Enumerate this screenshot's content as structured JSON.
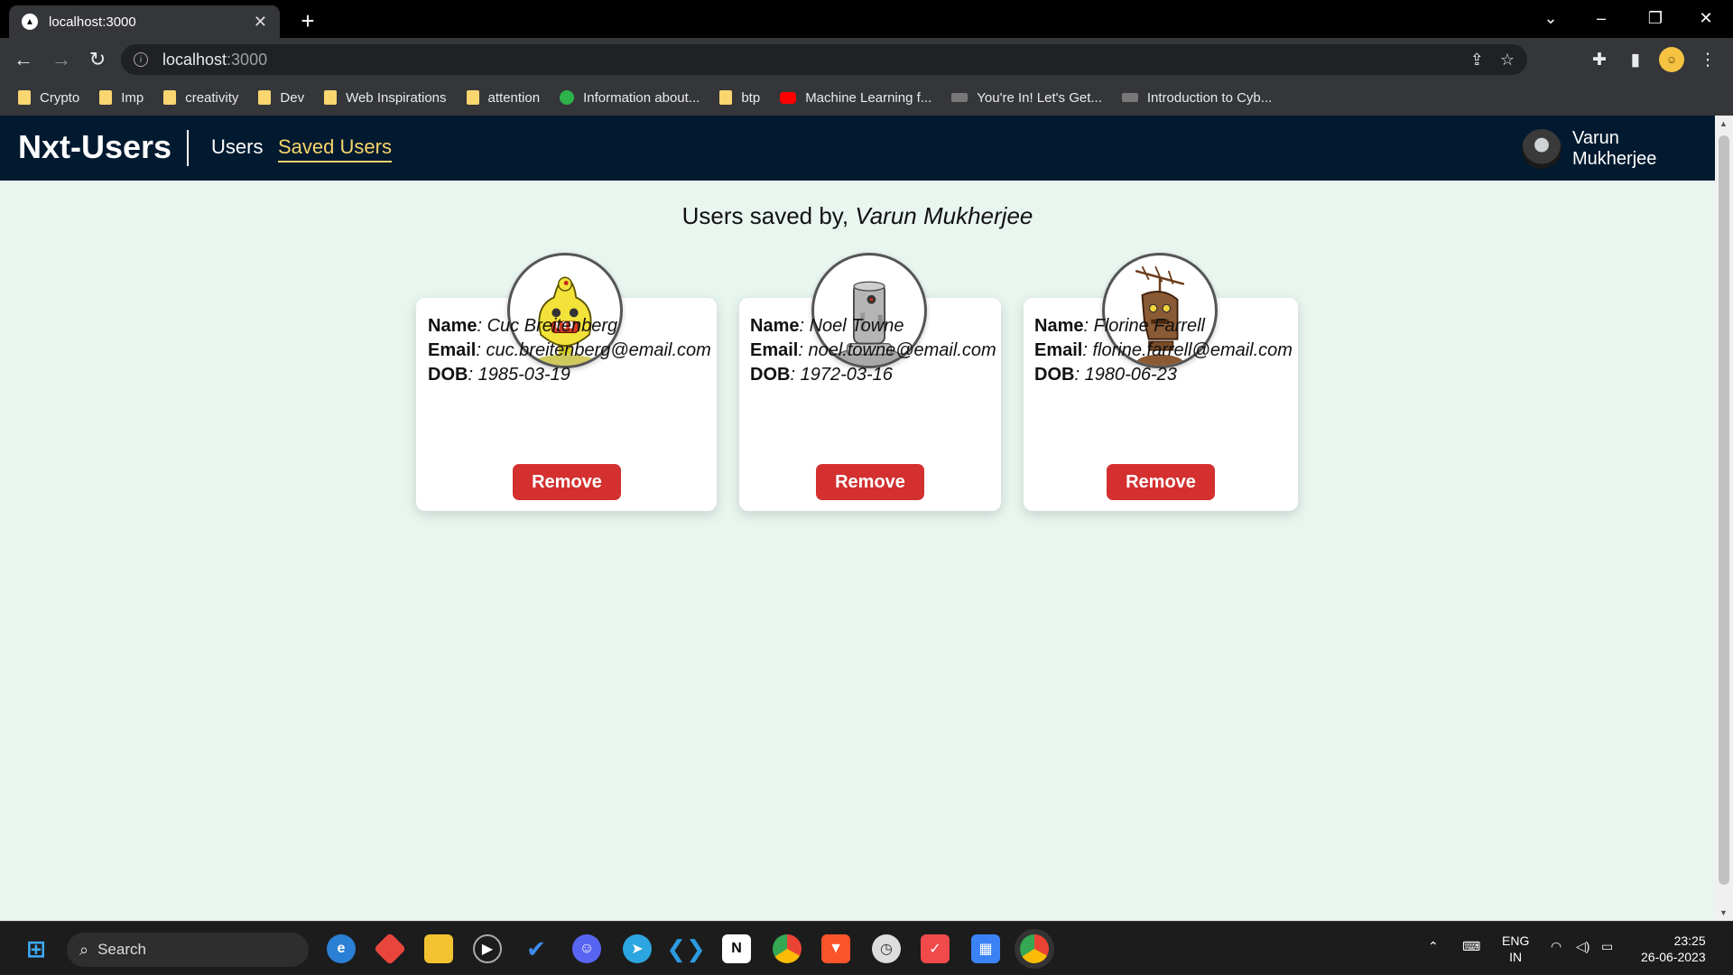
{
  "browser": {
    "tab_title": "localhost:3000",
    "tab_close": "✕",
    "new_tab": "+",
    "url_host": "localhost",
    "url_port": ":3000",
    "bookmarks": [
      {
        "label": "Crypto",
        "icon": "folder-icon"
      },
      {
        "label": "Imp",
        "icon": "folder-icon"
      },
      {
        "label": "creativity",
        "icon": "folder-icon"
      },
      {
        "label": "Dev",
        "icon": "folder-icon"
      },
      {
        "label": "Web Inspirations",
        "icon": "folder-icon"
      },
      {
        "label": "attention",
        "icon": "folder-icon"
      },
      {
        "label": "Information about...",
        "icon": "tv-icon"
      },
      {
        "label": "btp",
        "icon": "folder-icon"
      },
      {
        "label": "Machine Learning f...",
        "icon": "youtube-icon"
      },
      {
        "label": "You're In! Let's Get...",
        "icon": "site-icon"
      },
      {
        "label": "Introduction to Cyb...",
        "icon": "site-icon"
      }
    ]
  },
  "app": {
    "brand": "Nxt-Users",
    "nav": {
      "users": "Users",
      "saved_users": "Saved Users"
    },
    "current_user": "Varun Mukherjee",
    "heading_prefix": "Users saved by,",
    "heading_name": "Varun Mukherjee",
    "labels": {
      "name": "Name",
      "email": "Email",
      "dob": "DOB",
      "remove": "Remove"
    },
    "users": [
      {
        "name": "Cuc Breitenberg",
        "email": "cuc.breitenberg@email.com",
        "dob": "1985-03-19",
        "avatar_color": "#f3e23a"
      },
      {
        "name": "Noel Towne",
        "email": "noel.towne@email.com",
        "dob": "1972-03-16",
        "avatar_color": "#9a9a9a"
      },
      {
        "name": "Florine Farrell",
        "email": "florine.farrell@email.com",
        "dob": "1980-06-23",
        "avatar_color": "#8a5a35"
      }
    ]
  },
  "taskbar": {
    "search_label": "Search",
    "lang_top": "ENG",
    "lang_bottom": "IN",
    "time": "23:25",
    "date": "26-06-2023"
  }
}
